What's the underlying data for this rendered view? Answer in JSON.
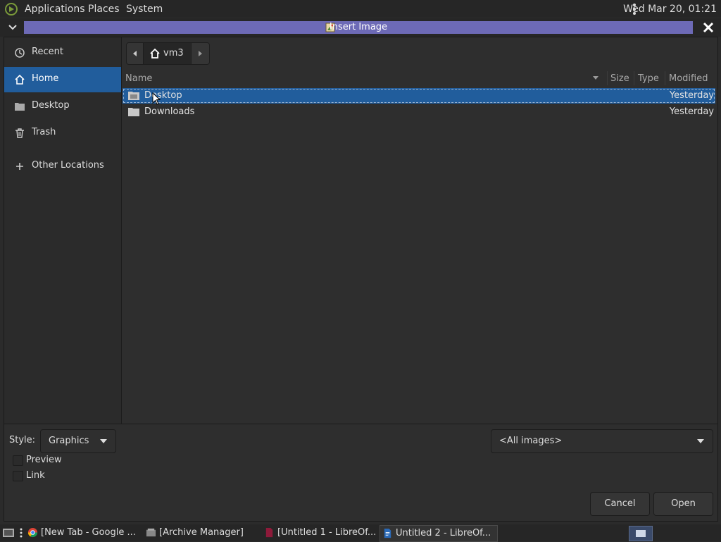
{
  "top_panel": {
    "menus": [
      "Applications",
      "Places",
      "System"
    ],
    "clock": "Wed Mar 20, 01:21"
  },
  "window": {
    "title": "Insert Image"
  },
  "sidebar": {
    "items": [
      {
        "label": "Recent",
        "icon": "clock-icon"
      },
      {
        "label": "Home",
        "icon": "home-icon",
        "active": true
      },
      {
        "label": "Desktop",
        "icon": "desktop-icon"
      },
      {
        "label": "Trash",
        "icon": "trash-icon"
      },
      {
        "label": "Other Locations",
        "icon": "plus-icon"
      }
    ]
  },
  "pathbar": {
    "current": "vm3"
  },
  "file_list": {
    "columns": [
      "Name",
      "Size",
      "Type",
      "Modified"
    ],
    "rows": [
      {
        "name": "Desktop",
        "modified": "Yesterday",
        "selected": true
      },
      {
        "name": "Downloads",
        "modified": "Yesterday",
        "selected": false
      }
    ]
  },
  "options": {
    "style_label": "Style:",
    "style_value": "Graphics",
    "filter_value": "<All images>",
    "preview_label": "Preview",
    "link_label": "Link"
  },
  "buttons": {
    "cancel": "Cancel",
    "open": "Open"
  },
  "taskbar": {
    "tasks": [
      {
        "label": "[New Tab - Google ...",
        "icon": "chrome-icon"
      },
      {
        "label": "[Archive Manager]",
        "icon": "archive-icon"
      },
      {
        "label": "[Untitled 1 - LibreOf...",
        "icon": "libreoffice-icon"
      },
      {
        "label": "Untitled 2 - LibreOf...",
        "icon": "writer-icon",
        "active": true
      }
    ]
  },
  "colors": {
    "selection": "#215d9c",
    "title_strip": "#6d6ab6"
  }
}
